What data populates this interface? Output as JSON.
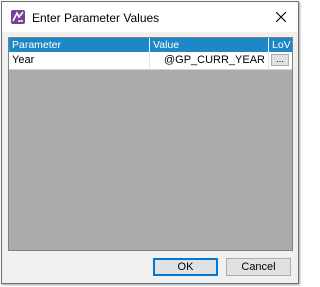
{
  "window": {
    "title": "Enter Parameter Values"
  },
  "grid": {
    "columns": [
      "Parameter",
      "Value",
      "LoV"
    ],
    "rows": [
      {
        "parameter": "Year",
        "value": "@GP_CURR_YEAR",
        "lov_label": "..."
      }
    ]
  },
  "buttons": {
    "ok_label": "OK",
    "cancel_label": "Cancel"
  },
  "colors": {
    "header_bg": "#1e87c8",
    "grid_empty_bg": "#ababab",
    "app_icon": "#7d3c98",
    "ok_border": "#0078d7"
  },
  "icons": {
    "app": "parameter-app-icon",
    "close": "close-icon"
  }
}
